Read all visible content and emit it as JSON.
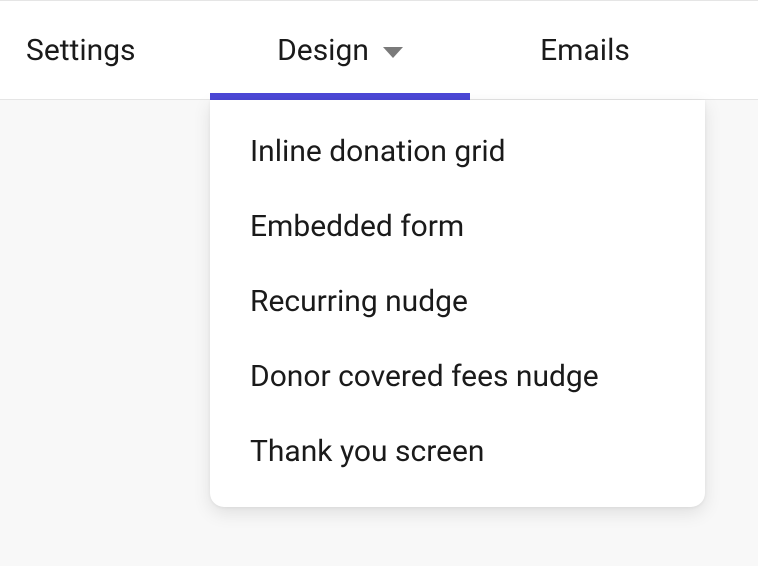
{
  "tabs": {
    "settings": {
      "label": "Settings"
    },
    "design": {
      "label": "Design",
      "active": true
    },
    "emails": {
      "label": "Emails"
    }
  },
  "design_dropdown": {
    "items": [
      {
        "label": "Inline donation grid"
      },
      {
        "label": "Embedded form"
      },
      {
        "label": "Recurring nudge"
      },
      {
        "label": "Donor covered fees nudge"
      },
      {
        "label": "Thank you screen"
      }
    ]
  },
  "colors": {
    "active_tab_indicator": "#4b47d6"
  }
}
